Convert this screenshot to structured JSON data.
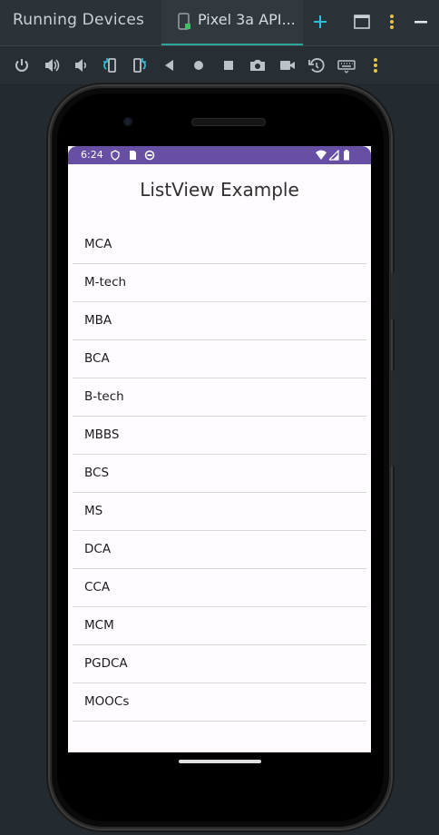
{
  "window": {
    "title": "Running Devices",
    "tab_label": "Pixel 3a API..."
  },
  "toolbar": {
    "tools": [
      "power-icon",
      "volume-up-icon",
      "volume-down-icon",
      "rotate-left-icon",
      "rotate-right-icon",
      "back-icon",
      "home-icon",
      "overview-icon",
      "camera-icon",
      "screen-record-icon",
      "snapshot-icon",
      "keyboard-icon",
      "more-vertical-icon"
    ]
  },
  "device": {
    "status_time": "6:24",
    "app_title": "ListView Example",
    "items": [
      "MCA",
      "M-tech",
      "MBA",
      "BCA",
      "B-tech",
      "MBBS",
      "BCS",
      "MS",
      "DCA",
      "CCA",
      "MCM",
      "PGDCA",
      "MOOCs"
    ]
  },
  "colors": {
    "accent": "#2fa79a",
    "status_bar": "#6750a4",
    "screen_bg": "#fffbfe"
  }
}
